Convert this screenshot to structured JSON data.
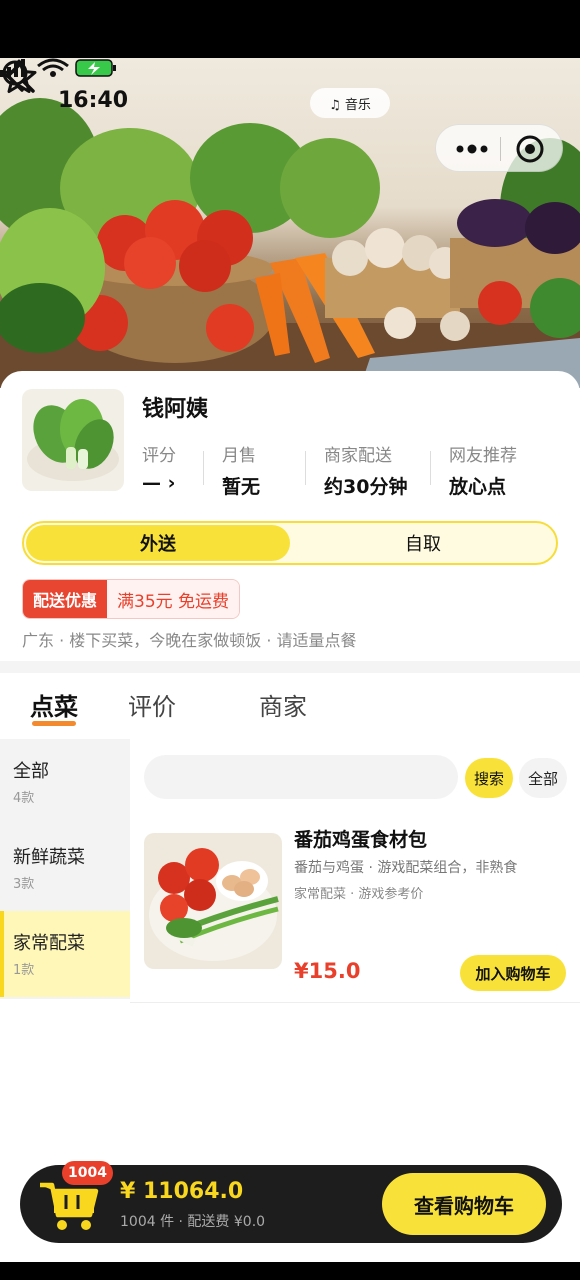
{
  "status_bar": {
    "time": "16:40",
    "music": "♫ 音乐"
  },
  "shop": {
    "name": "钱阿姨",
    "stats": [
      {
        "label": "评分",
        "value": "— ›"
      },
      {
        "label": "月售",
        "value": "暂无"
      },
      {
        "label": "商家配送",
        "value": "约30分钟"
      },
      {
        "label": "网友推荐",
        "value": "放心点"
      }
    ],
    "mode_toggle": {
      "delivery": "外送",
      "pickup": "自取",
      "selected": "外送"
    },
    "promo": {
      "tag": "配送优惠",
      "text": "满35元 免运费"
    },
    "notice": "广东 · 楼下买菜，今晚在家做顿饭 · 请适量点餐"
  },
  "tabs": [
    {
      "label": "点菜",
      "active": true
    },
    {
      "label": "评价",
      "active": false
    },
    {
      "label": "商家",
      "active": false
    }
  ],
  "categories": [
    {
      "name": "全部",
      "count": "4款",
      "active": false
    },
    {
      "name": "新鲜蔬菜",
      "count": "3款",
      "active": false
    },
    {
      "name": "家常配菜",
      "count": "1款",
      "active": true
    }
  ],
  "search": {
    "placeholder": "",
    "button": "搜索",
    "all_button": "全部"
  },
  "products": [
    {
      "title": "番茄鸡蛋食材包",
      "desc": "番茄与鸡蛋 · 游戏配菜组合，非熟食",
      "tags": "家常配菜 · 游戏参考价",
      "price": "¥15.0",
      "add_label": "加入购物车"
    }
  ],
  "cart": {
    "badge": "1004",
    "total": "¥ 11064.0",
    "subtitle": "1004 件 · 配送费 ¥0.0",
    "button": "查看购物车"
  },
  "colors": {
    "accent_yellow": "#f8e23a",
    "price_red": "#e9402c",
    "tab_underline": "#f38a2e",
    "cart_bar": "#1d1d1d"
  }
}
